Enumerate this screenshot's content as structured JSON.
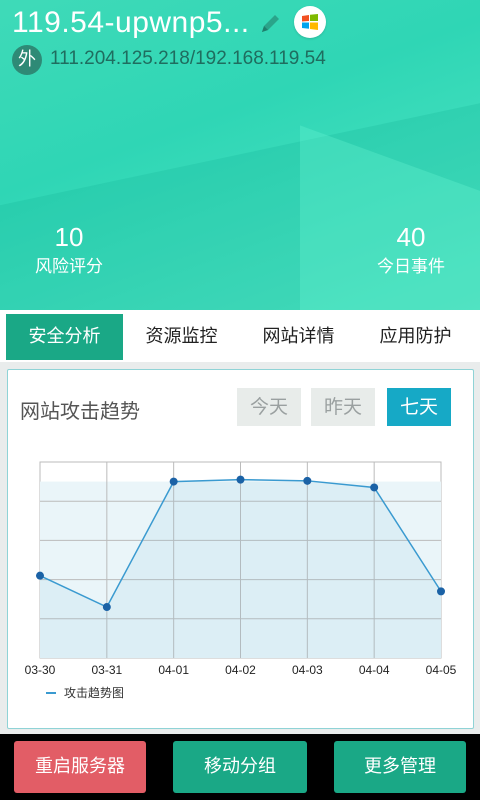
{
  "header": {
    "host_title": "119.54-upwnp5...",
    "ip_badge": "外",
    "ip_text": "111.204.125.218/192.168.119.54",
    "os_icon": "windows-logo-icon",
    "edit_icon": "pencil-icon",
    "stats": [
      {
        "value": "10",
        "label": "风险评分"
      },
      {
        "value": "40",
        "label": "今日事件"
      }
    ]
  },
  "tabs": [
    {
      "label": "安全分析",
      "active": true
    },
    {
      "label": "资源监控",
      "active": false
    },
    {
      "label": "网站详情",
      "active": false
    },
    {
      "label": "应用防护",
      "active": false
    }
  ],
  "chart_card": {
    "title": "网站攻击趋势",
    "ranges": [
      {
        "label": "今天",
        "active": false
      },
      {
        "label": "昨天",
        "active": false
      },
      {
        "label": "七天",
        "active": true
      }
    ]
  },
  "chart_data": {
    "type": "area",
    "categories": [
      "03-30",
      "03-31",
      "04-01",
      "04-02",
      "04-03",
      "04-04",
      "04-05"
    ],
    "series": [
      {
        "name": "攻击趋势图",
        "values": [
          2.1,
          1.3,
          4.5,
          4.55,
          4.52,
          4.35,
          1.7
        ],
        "color": "#3a9ad0"
      }
    ],
    "ylim": [
      0,
      5
    ],
    "grid": true,
    "legend": "bottom-left"
  },
  "bottom_actions": [
    {
      "label": "重启服务器",
      "color": "#e25d66"
    },
    {
      "label": "移动分组",
      "color": "#1aa886"
    },
    {
      "label": "更多管理",
      "color": "#1aa886"
    }
  ]
}
